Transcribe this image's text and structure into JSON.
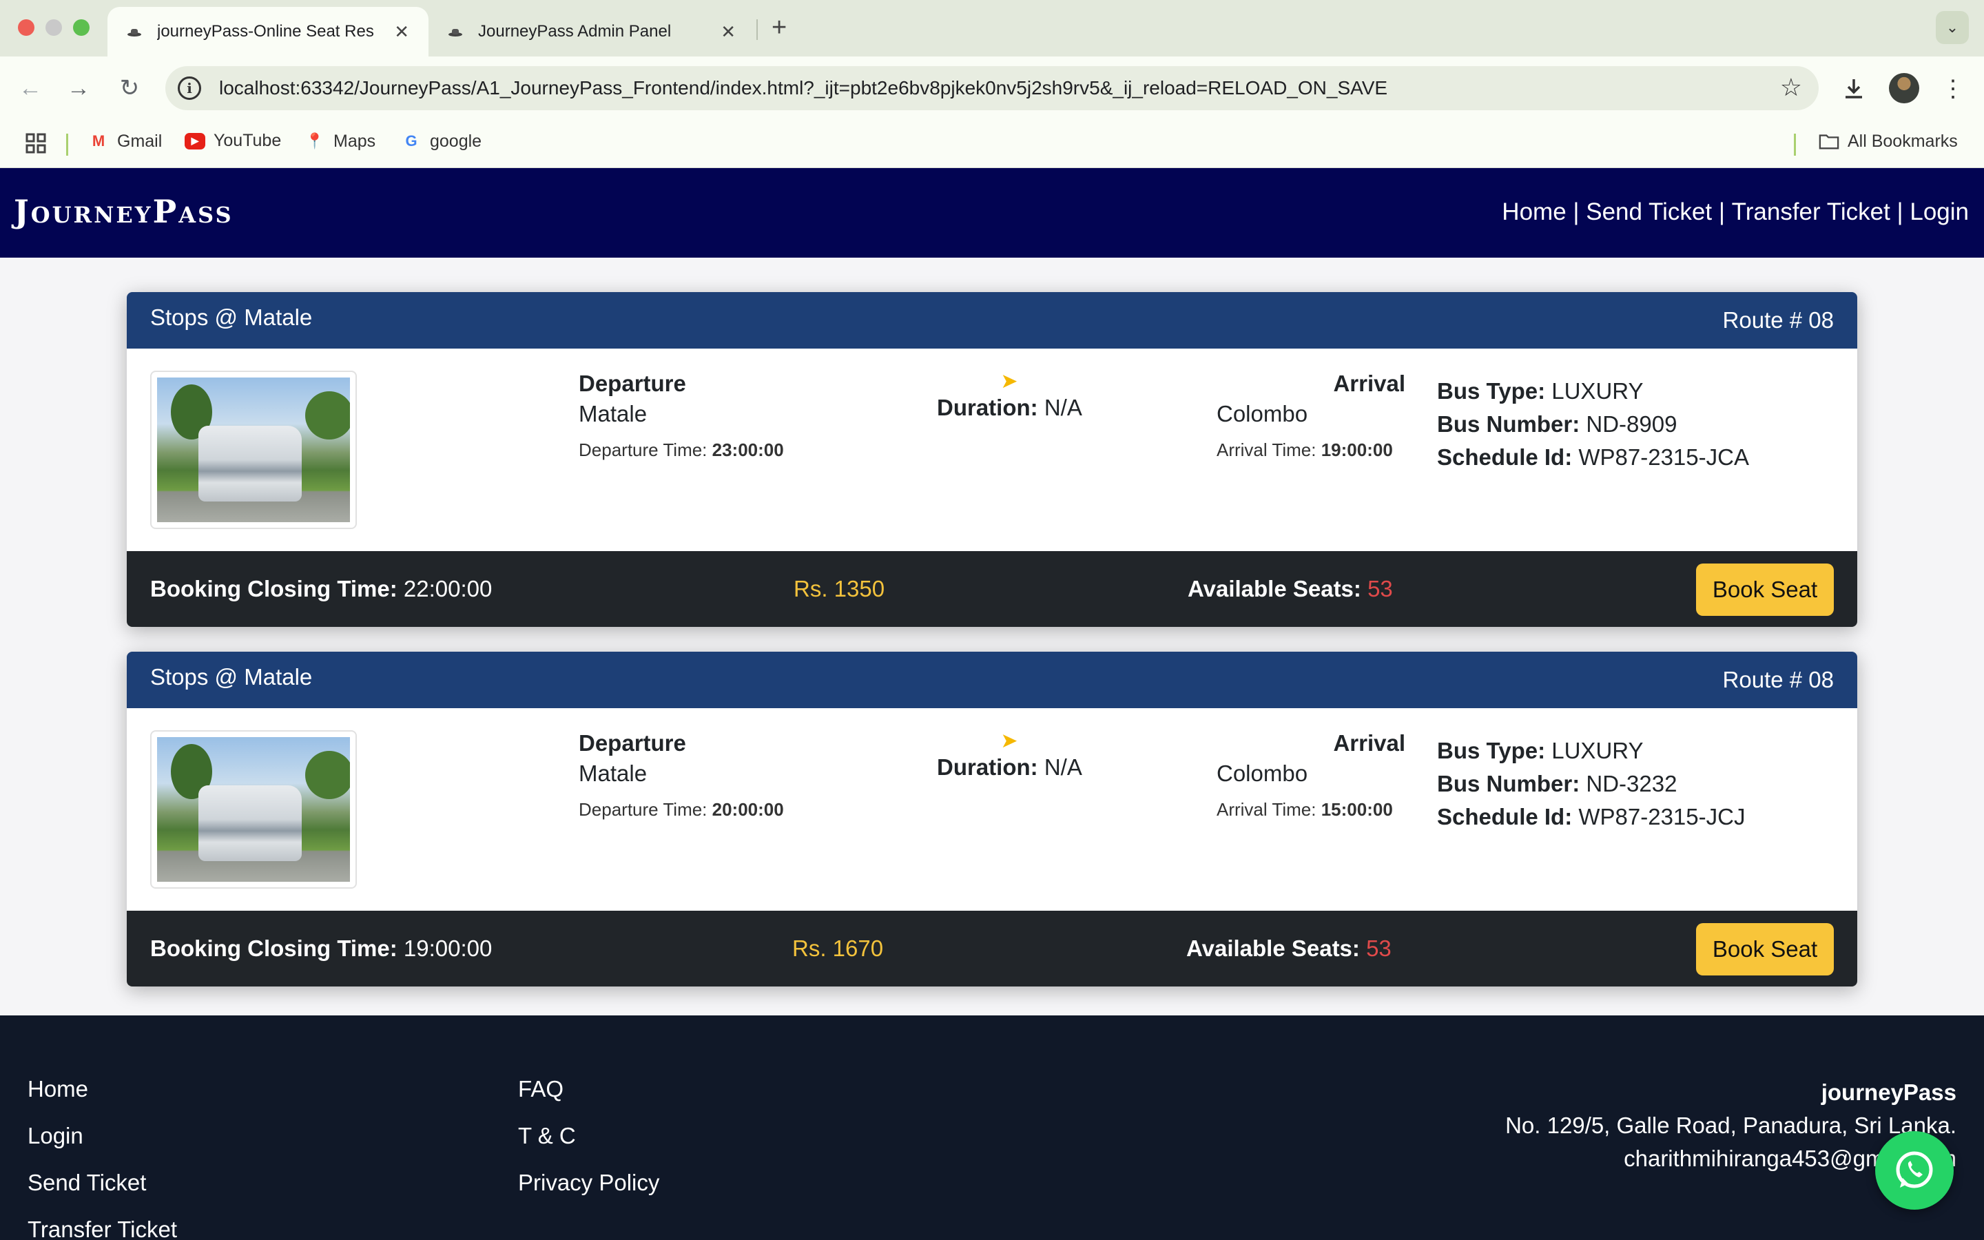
{
  "browser": {
    "tabs": [
      {
        "title": "journeyPass-Online Seat Res",
        "active": true
      },
      {
        "title": "JourneyPass Admin Panel",
        "active": false
      }
    ],
    "url": "localhost:63342/JourneyPass/A1_JourneyPass_Frontend/index.html?_ijt=pbt2e6bv8pjkek0nv5j2sh9rv5&_ij_reload=RELOAD_ON_SAVE",
    "bookmarks": [
      "Gmail",
      "YouTube",
      "Maps",
      "google"
    ],
    "all_bookmarks": "All Bookmarks"
  },
  "navbar": {
    "brand": "JourneyPass",
    "links": [
      "Home",
      "Send Ticket",
      "Transfer Ticket",
      "Login"
    ],
    "separator": " | "
  },
  "cards": [
    {
      "stops": "Stops @ Matale",
      "route": "Route # 08",
      "departure_label": "Departure",
      "departure_city": "Matale",
      "departure_time_label": "Departure Time:",
      "departure_time": "23:00:00",
      "duration_label": "Duration:",
      "duration": "N/A",
      "arrival_label": "Arrival",
      "arrival_city": "Colombo",
      "arrival_time_label": "Arrival Time:",
      "arrival_time": "19:00:00",
      "bus_type_label": "Bus Type:",
      "bus_type": "LUXURY",
      "bus_number_label": "Bus Number:",
      "bus_number": "ND-8909",
      "schedule_label": "Schedule Id:",
      "schedule_id": "WP87-2315-JCA",
      "closing_label": "Booking Closing Time:",
      "closing_time": "22:00:00",
      "price": "Rs. 1350",
      "seats_label": "Available Seats:",
      "seats": "53",
      "book_label": "Book Seat"
    },
    {
      "stops": "Stops @ Matale",
      "route": "Route # 08",
      "departure_label": "Departure",
      "departure_city": "Matale",
      "departure_time_label": "Departure Time:",
      "departure_time": "20:00:00",
      "duration_label": "Duration:",
      "duration": "N/A",
      "arrival_label": "Arrival",
      "arrival_city": "Colombo",
      "arrival_time_label": "Arrival Time:",
      "arrival_time": "15:00:00",
      "bus_type_label": "Bus Type:",
      "bus_type": "LUXURY",
      "bus_number_label": "Bus Number:",
      "bus_number": "ND-3232",
      "schedule_label": "Schedule Id:",
      "schedule_id": "WP87-2315-JCJ",
      "closing_label": "Booking Closing Time:",
      "closing_time": "19:00:00",
      "price": "Rs. 1670",
      "seats_label": "Available Seats:",
      "seats": "53",
      "book_label": "Book Seat"
    }
  ],
  "footer": {
    "col1": [
      "Home",
      "Login",
      "Send Ticket",
      "Transfer Ticket"
    ],
    "col2": [
      "FAQ",
      "T & C",
      "Privacy Policy"
    ],
    "company": "journeyPass",
    "address": "No. 129/5, Galle Road, Panadura, Sri Lanka.",
    "email": "charithmihiranga453@gmail.com"
  },
  "colors": {
    "navbar": "#020452",
    "card_header": "#1d3f76",
    "card_footer": "#212529",
    "accent": "#f8c53a",
    "seats": "#e04a4a",
    "footer": "#101828"
  }
}
